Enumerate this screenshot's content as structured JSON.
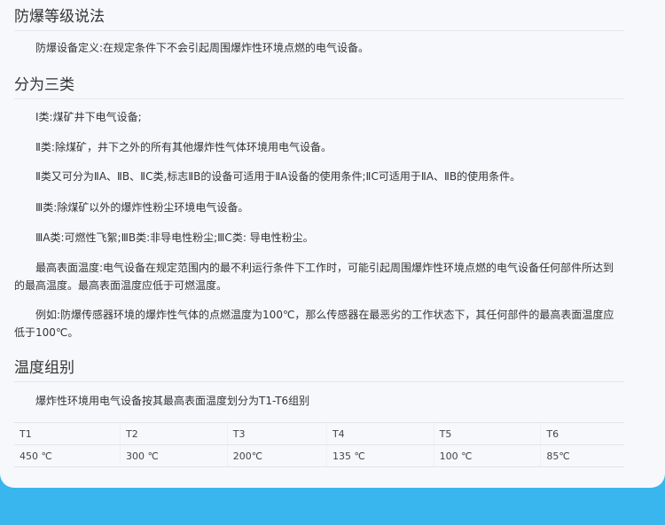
{
  "sections": {
    "s1_title": "防爆等级说法",
    "s1_p1": "防爆设备定义:在规定条件下不会引起周围爆炸性环境点燃的电气设备。",
    "s2_title": "分为三类",
    "s2_p1": "Ⅰ类:煤矿井下电气设备;",
    "s2_p2": "Ⅱ类:除煤矿，井下之外的所有其他爆炸性气体环境用电气设备。",
    "s2_p3": "Ⅱ类又可分为ⅡA、ⅡB、ⅡC类,标志ⅡB的设备可适用于ⅡA设备的使用条件;ⅡC可适用于ⅡA、ⅡB的使用条件。",
    "s2_p4": "Ⅲ类:除煤矿以外的爆炸性粉尘环境电气设备。",
    "s2_p5": "ⅢA类:可燃性飞絮;ⅢB类:非导电性粉尘;ⅢC类: 导电性粉尘。",
    "s2_p6": "最高表面温度:电气设备在规定范围内的最不利运行条件下工作时，可能引起周围爆炸性环境点燃的电气设备任何部件所达到的最高温度。最高表面温度应低于可燃温度。",
    "s2_p7": "例如:防爆传感器环境的爆炸性气体的点燃温度为100℃，那么传感器在最恶劣的工作状态下，其任何部件的最高表面温度应低于100℃。",
    "s3_title": "温度组别",
    "s3_p1": "爆炸性环境用电气设备按其最高表面温度划分为T1-T6组别"
  },
  "table": {
    "headers": [
      "T1",
      "T2",
      "T3",
      "T4",
      "T5",
      "T6"
    ],
    "values": [
      "450 ℃",
      "300 ℃",
      "200℃",
      "135 ℃",
      "100 ℃",
      "85℃"
    ]
  }
}
